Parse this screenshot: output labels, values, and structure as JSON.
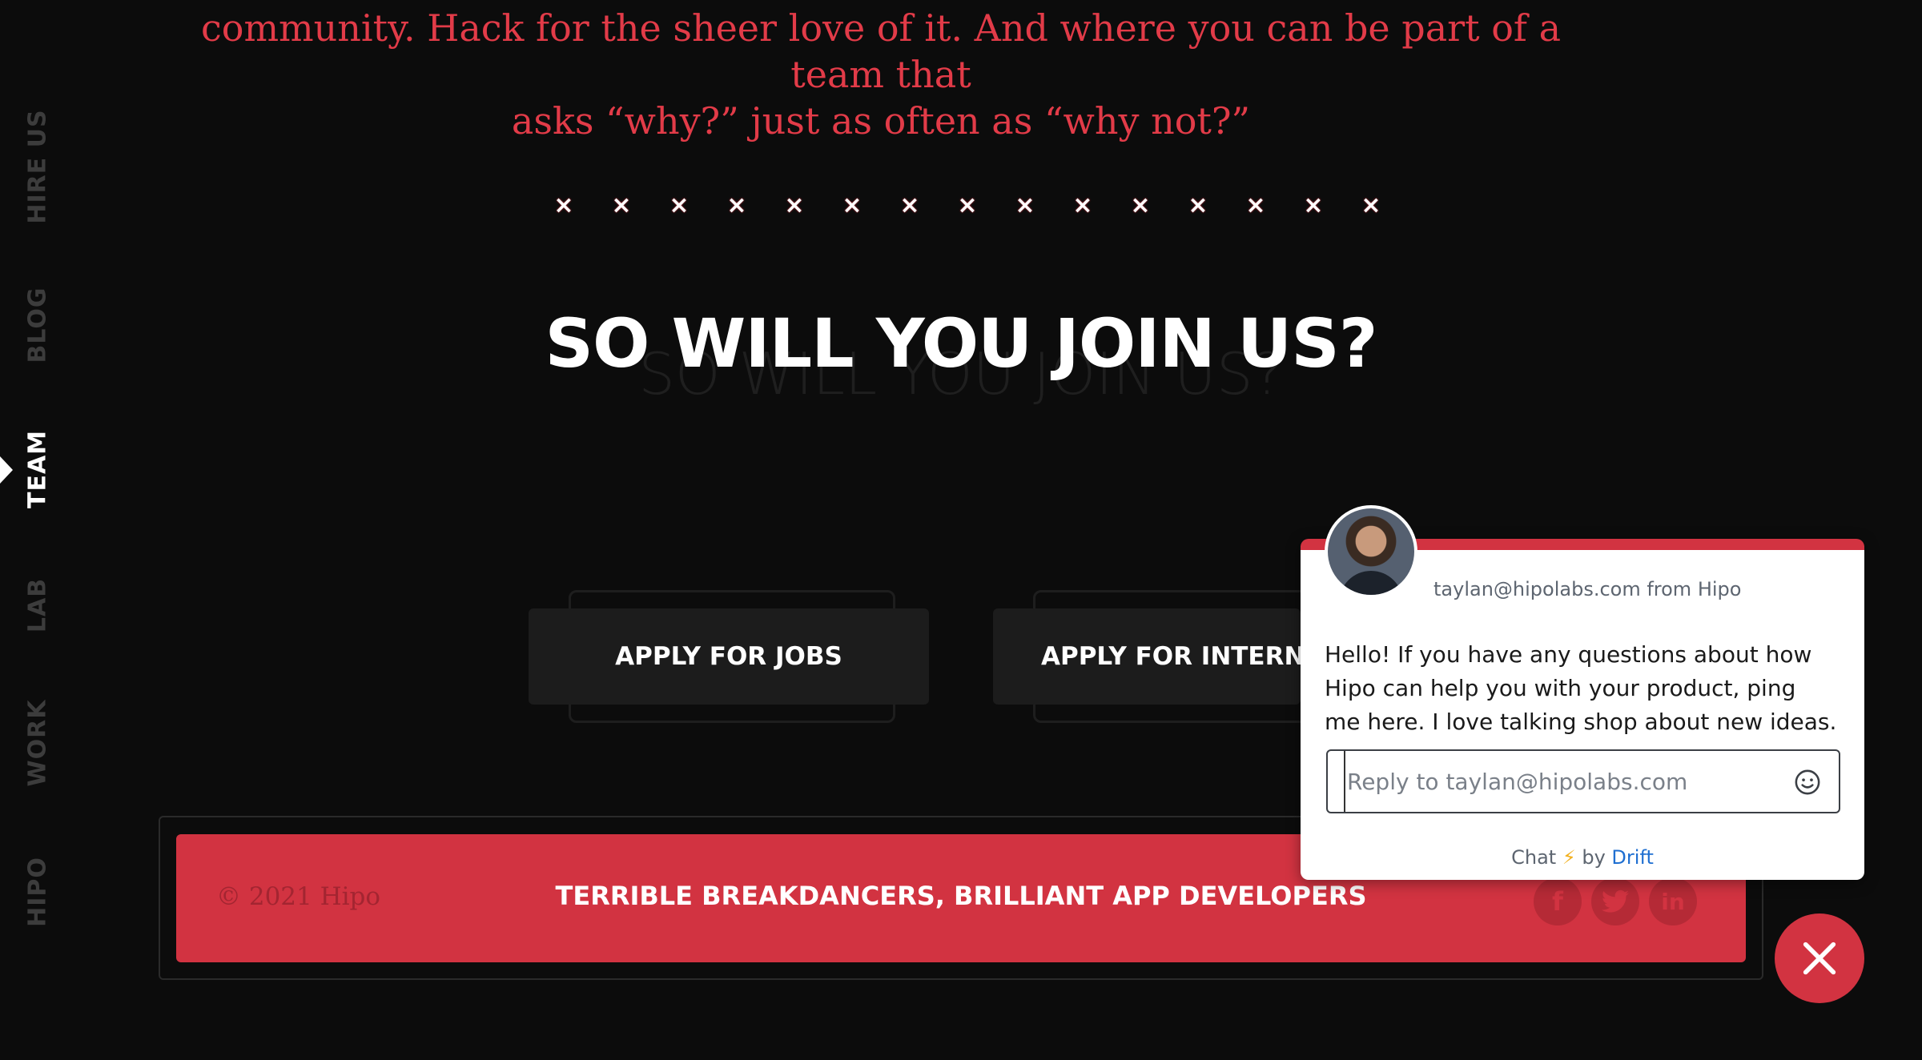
{
  "nav": {
    "items": [
      {
        "label": "HIRE US",
        "active": false
      },
      {
        "label": "BLOG",
        "active": false
      },
      {
        "label": "TEAM",
        "active": true
      },
      {
        "label": "LAB",
        "active": false
      },
      {
        "label": "WORK",
        "active": false
      },
      {
        "label": "HIPO",
        "active": false
      }
    ]
  },
  "intro": {
    "line1": "community. Hack for the sheer love of it. And where you can be part of a team that",
    "line2": "asks “why?” just as often as “why not?”"
  },
  "separator": {
    "glyph": "×",
    "count": 15
  },
  "join": {
    "title": "SO WILL YOU JOIN US?"
  },
  "buttons": {
    "jobs": "APPLY FOR JOBS",
    "internships": "APPLY FOR INTERNSHIPS"
  },
  "footer": {
    "copyright": "© 2021 Hipo",
    "tagline": "TERRIBLE BREAKDANCERS, BRILLIANT APP DEVELOPERS",
    "social": [
      "facebook-icon",
      "twitter-icon",
      "linkedin-icon"
    ]
  },
  "chat": {
    "from": "taylan@hipolabs.com from Hipo",
    "message": "Hello! If you have any questions about how Hipo can help you with your product, ping me here. I love talking shop about new ideas.",
    "input_placeholder": "Reply to taylan@hipolabs.com",
    "branding_chat": "Chat",
    "branding_by": "by",
    "branding_drift": "Drift"
  },
  "colors": {
    "accent": "#d23341",
    "intro_text": "#e23b48",
    "background": "#0c0c0c"
  }
}
